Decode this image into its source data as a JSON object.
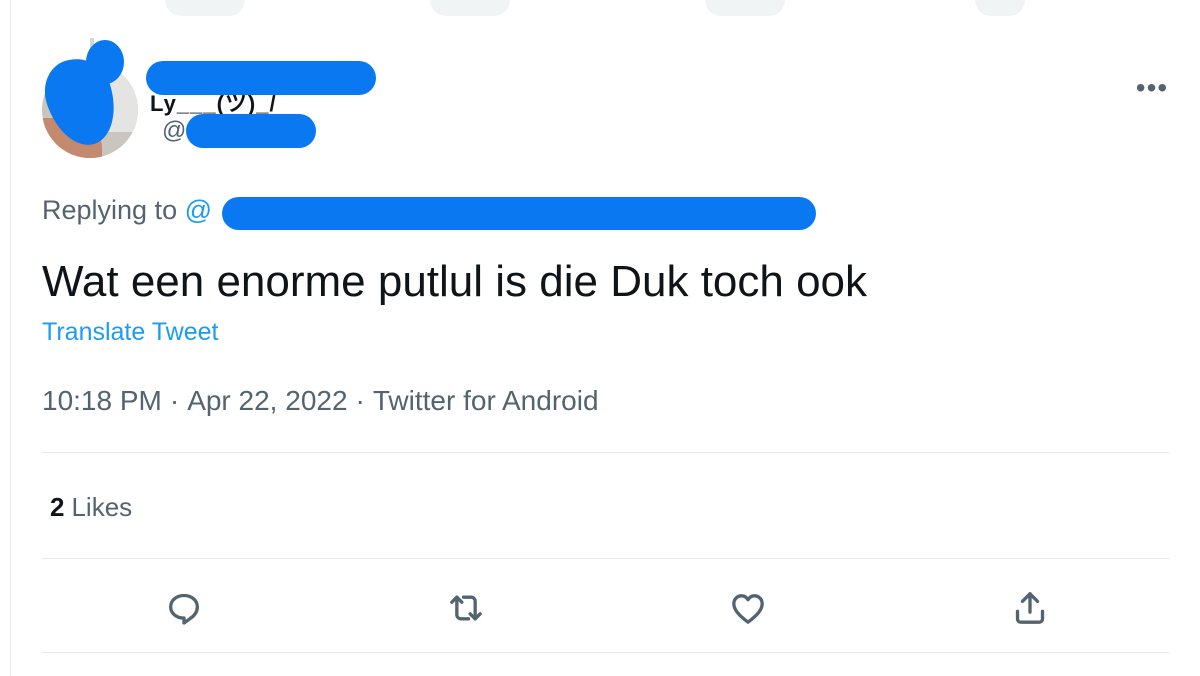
{
  "author": {
    "name_visible_fragment": "Ly___(ツ)_/",
    "handle_prefix": "@"
  },
  "reply": {
    "label": "Replying to ",
    "mention_prefix": "@"
  },
  "tweet": {
    "text": "Wat een enorme putlul is die Duk toch ook",
    "translate_label": "Translate Tweet"
  },
  "meta": {
    "time": "10:18 PM",
    "separator": "·",
    "date": "Apr 22, 2022",
    "source": "Twitter for Android"
  },
  "stats": {
    "likes_count": "2",
    "likes_label": "Likes"
  },
  "menu": {
    "more_label": "•••"
  },
  "actions": [
    {
      "name": "reply",
      "icon": "reply-icon"
    },
    {
      "name": "retweet",
      "icon": "retweet-icon"
    },
    {
      "name": "like",
      "icon": "heart-icon"
    },
    {
      "name": "share",
      "icon": "share-icon"
    }
  ],
  "colors": {
    "redaction": "#0a78f0",
    "link": "#1d9bf0",
    "secondary_text": "#536471",
    "primary_text": "#0f1419"
  }
}
